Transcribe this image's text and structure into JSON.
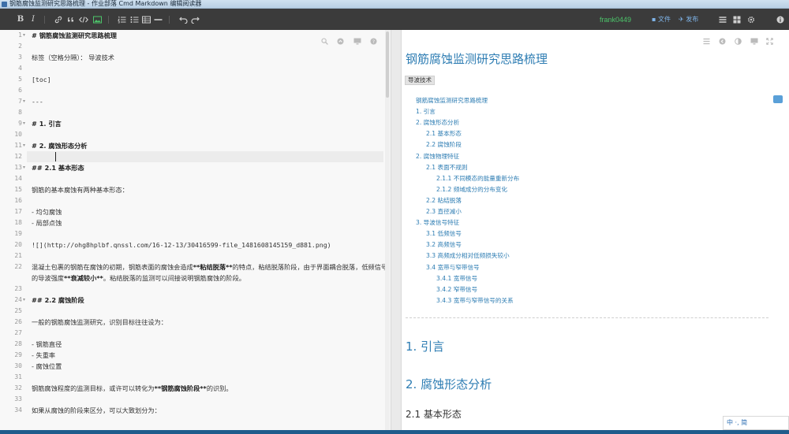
{
  "window": {
    "title": "钢筋腐蚀监测研究思路梳理 - 作业部落 Cmd Markdown 编辑阅读器"
  },
  "toolbar": {
    "bold": "B",
    "italic": "I",
    "user": "frank0449",
    "file_label": "文件",
    "publish_label": "发布"
  },
  "editor": {
    "lines": [
      {
        "n": "1",
        "t": "# 钢筋腐蚀监测研究思路梳理"
      },
      {
        "n": "2",
        "t": ""
      },
      {
        "n": "3",
        "t": "标签（空格分隔）： 导波技术"
      },
      {
        "n": "4",
        "t": ""
      },
      {
        "n": "5",
        "t": "[toc]"
      },
      {
        "n": "6",
        "t": ""
      },
      {
        "n": "7",
        "t": "---"
      },
      {
        "n": "8",
        "t": ""
      },
      {
        "n": "9",
        "t": "# 1. 引言"
      },
      {
        "n": "10",
        "t": ""
      },
      {
        "n": "11",
        "t": "# 2. 腐蚀形态分析"
      },
      {
        "n": "12",
        "t": ""
      },
      {
        "n": "13",
        "t": "## 2.1 基本形态"
      },
      {
        "n": "14",
        "t": ""
      },
      {
        "n": "15",
        "t": "钢筋的基本腐蚀有两种基本形态："
      },
      {
        "n": "16",
        "t": ""
      },
      {
        "n": "17",
        "t": "- 均匀腐蚀"
      },
      {
        "n": "18",
        "t": "- 局部点蚀"
      },
      {
        "n": "19",
        "t": ""
      },
      {
        "n": "20",
        "t": "![](http://ohg8hplbf.qnssl.com/16-12-13/30416599-file_1481608145159_d881.png)"
      },
      {
        "n": "21",
        "t": ""
      },
      {
        "n": "22",
        "a": "混凝土包裹的钢筋在腐蚀的初期，钢筋表面的腐蚀会造成",
        "b1": "**粘结脱落**",
        "c": "的特点，粘结脱落阶段，由于界面耦合脱落，低频信号的导波强度",
        "b2": "**衰减较小**",
        "d": "。粘结脱落的监测可以间接说明钢筋腐蚀的阶段。"
      },
      {
        "n": "23",
        "t": ""
      },
      {
        "n": "24",
        "t": "## 2.2 腐蚀阶段"
      },
      {
        "n": "25",
        "t": ""
      },
      {
        "n": "26",
        "t": "一般的钢筋腐蚀监测研究，识别目标往往设为："
      },
      {
        "n": "27",
        "t": ""
      },
      {
        "n": "28",
        "t": "- 钢筋直径"
      },
      {
        "n": "29",
        "t": "- 失重率"
      },
      {
        "n": "30",
        "t": "- 腐蚀位置"
      },
      {
        "n": "31",
        "t": ""
      },
      {
        "n": "32",
        "a": "钢筋腐蚀程度的监测目标，或许可以转化为",
        "b1": "**钢筋腐蚀阶段**",
        "c": "的识别。"
      },
      {
        "n": "33",
        "t": ""
      },
      {
        "n": "34",
        "t": "如果从腐蚀的阶段来区分，可以大致划分为："
      }
    ]
  },
  "preview": {
    "title": "钢筋腐蚀监测研究思路梳理",
    "tag": "导波技术",
    "toc": [
      {
        "level": 0,
        "text": "钢筋腐蚀监测研究思路梳理"
      },
      {
        "level": 1,
        "text": "1. 引言"
      },
      {
        "level": 1,
        "text": "2. 腐蚀形态分析"
      },
      {
        "level": 2,
        "text": "2.1 基本形态"
      },
      {
        "level": 2,
        "text": "2.2 腐蚀阶段"
      },
      {
        "level": 1,
        "text": "2. 腐蚀物理特征"
      },
      {
        "level": 2,
        "text": "2.1 表面不规则"
      },
      {
        "level": 3,
        "text": "2.1.1 不同模态的能量重新分布"
      },
      {
        "level": 3,
        "text": "2.1.2 频域成分的分布变化"
      },
      {
        "level": 2,
        "text": "2.2 粘结脱落"
      },
      {
        "level": 2,
        "text": "2.3 直径减小"
      },
      {
        "level": 1,
        "text": "3. 导波信号特征"
      },
      {
        "level": 2,
        "text": "3.1 低频信号"
      },
      {
        "level": 2,
        "text": "3.2 高频信号"
      },
      {
        "level": 2,
        "text": "3.3 高频成分相对低频损失较小"
      },
      {
        "level": 2,
        "text": "3.4 宽带与窄带信号"
      },
      {
        "level": 3,
        "text": "3.4.1 宽带信号"
      },
      {
        "level": 3,
        "text": "3.4.2 窄带信号"
      },
      {
        "level": 3,
        "text": "3.4.3 宽带与窄带信号的关系"
      }
    ],
    "h_intro": "1. 引言",
    "h_shape": "2. 腐蚀形态分析",
    "h_basic": "2.1 基本形态"
  },
  "ime": {
    "text": "中 ·, 简"
  },
  "colors": {
    "toolbar": "#3b3b3b",
    "accent": "#2e7db3",
    "user": "#4cc46a"
  }
}
